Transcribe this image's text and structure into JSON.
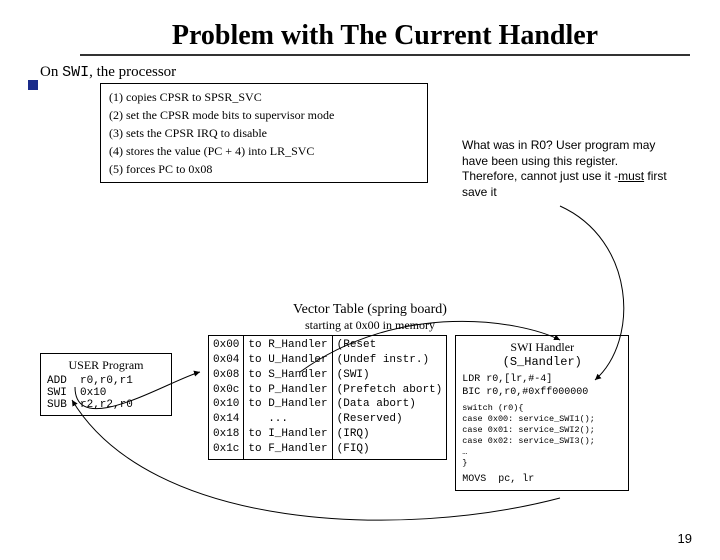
{
  "title": "Problem with The Current Handler",
  "swi_heading_pre": "On ",
  "swi_heading_code": "SWI",
  "swi_heading_post": ", the processor",
  "steps": [
    "(1) copies CPSR to SPSR_SVC",
    "(2) set the CPSR mode bits to supervisor mode",
    "(3) sets the CPSR  IRQ to disable",
    "(4) stores the value (PC  +  4) into LR_SVC",
    "(5) forces PC to 0x08"
  ],
  "note_l1": "What was in R0? User program may have been using this register. Therefore, cannot just use it -",
  "note_underline": "must",
  "note_l2": " first save it",
  "vt_title": "Vector Table (spring board)",
  "vt_sub": "starting at 0x00 in memory",
  "user_hdr": "USER Program",
  "user_code": "ADD  r0,r0,r1\nSWI  0x10\nSUB  r2,r2,r0",
  "vt_addr": "0x00\n0x04\n0x08\n0x0c\n0x10\n0x14\n0x18\n0x1c",
  "vt_to": "to R_Handler\nto U_Handler\nto S_Handler\nto P_Handler\nto D_Handler\n   ...\nto I_Handler\nto F_Handler",
  "vt_desc": "(Reset\n(Undef instr.)\n(SWI)\n(Prefetch abort)\n(Data abort)\n(Reserved)\n(IRQ)\n(FIQ)",
  "swi_hdr1": "SWI Handler",
  "swi_hdr2": "(S_Handler)",
  "swi_code1": "LDR r0,[lr,#-4]\nBIC r0,r0,#0xff000000",
  "swi_code2": "switch (r0){\ncase 0x00: service_SWI1();\ncase 0x01: service_SWI2();\ncase 0x02: service_SWI3();\n…\n}",
  "swi_code3": "MOVS  pc, lr",
  "pagenum": "19"
}
